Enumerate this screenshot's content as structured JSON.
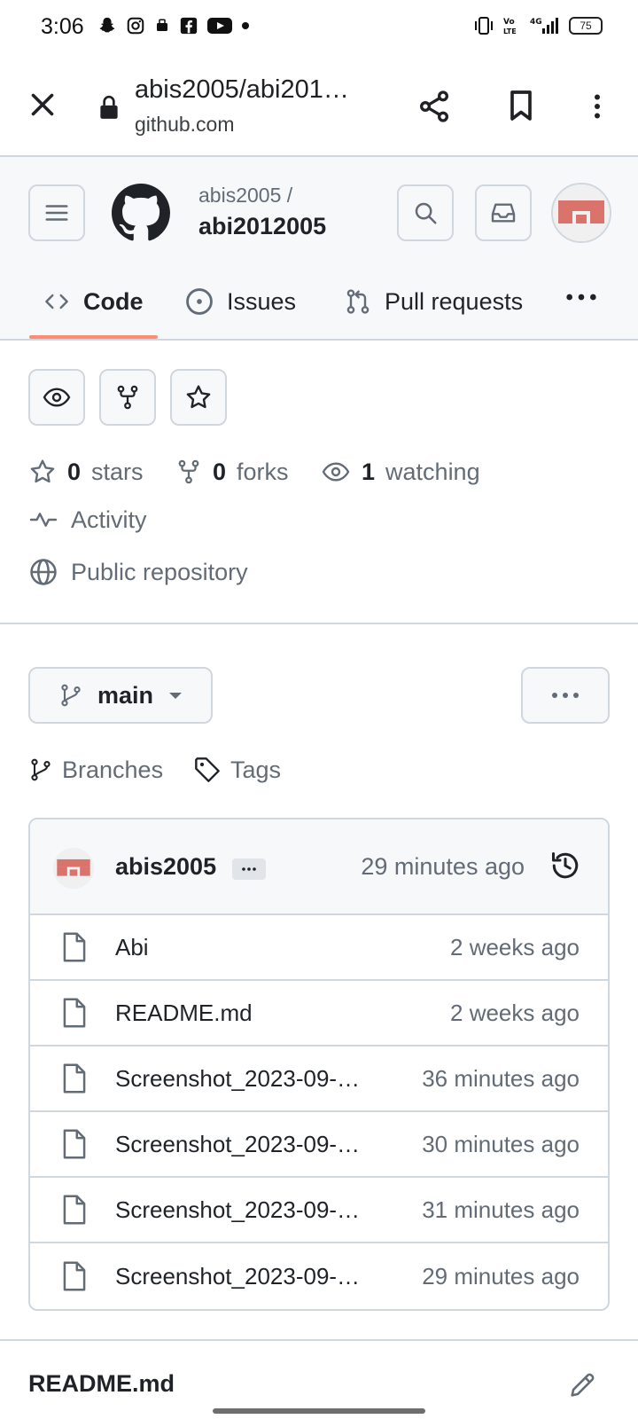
{
  "status_bar": {
    "time": "3:06",
    "battery": "75"
  },
  "browser": {
    "url_title": "abis2005/abi201…",
    "domain": "github.com"
  },
  "repo": {
    "owner": "abis2005 /",
    "name": "abi2012005"
  },
  "tabs": {
    "code": "Code",
    "issues": "Issues",
    "pulls": "Pull requests"
  },
  "stats": {
    "stars_count": "0",
    "stars_label": "stars",
    "forks_count": "0",
    "forks_label": "forks",
    "watching_count": "1",
    "watching_label": "watching",
    "activity": "Activity",
    "visibility": "Public repository"
  },
  "branch": {
    "name": "main",
    "branches_link": "Branches",
    "tags_link": "Tags"
  },
  "commit": {
    "author": "abis2005",
    "time": "29 minutes ago"
  },
  "files": [
    {
      "name": "Abi",
      "time": "2 weeks ago"
    },
    {
      "name": "README.md",
      "time": "2 weeks ago"
    },
    {
      "name": "Screenshot_2023-09-…",
      "time": "36 minutes ago"
    },
    {
      "name": "Screenshot_2023-09-…",
      "time": "30 minutes ago"
    },
    {
      "name": "Screenshot_2023-09-…",
      "time": "31 minutes ago"
    },
    {
      "name": "Screenshot_2023-09-…",
      "time": "29 minutes ago"
    }
  ],
  "readme": {
    "title": "README.md"
  },
  "colors": {
    "tab_underline": "#fd8c73",
    "avatar": "#d9736b"
  }
}
